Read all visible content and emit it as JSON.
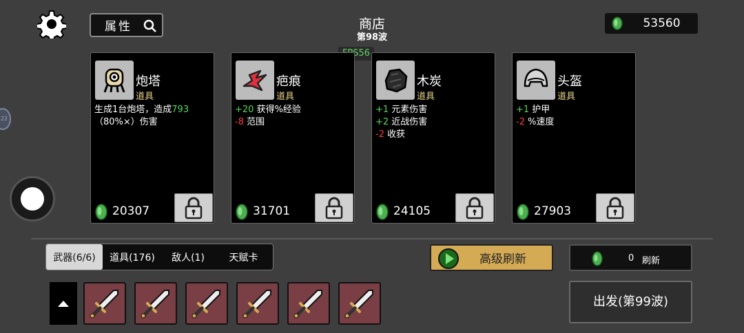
{
  "header": {
    "title": "商店",
    "wave": "第98波",
    "fps": "FPS56",
    "money": "53560",
    "search_label": "属性"
  },
  "side": {
    "badge": "22"
  },
  "cards": [
    {
      "name": "炮塔",
      "type": "道具",
      "icon": "turret-icon",
      "desc": [
        [
          {
            "t": "生成1台炮塔，造成"
          },
          {
            "t": "793",
            "c": "pos"
          },
          {
            "t": "（80%⨯）伤害"
          }
        ]
      ],
      "price": "20307"
    },
    {
      "name": "疤痕",
      "type": "道具",
      "icon": "scar-icon",
      "desc": [
        [
          {
            "t": "+20",
            "c": "pos"
          },
          {
            "t": " 获得%经验"
          }
        ],
        [
          {
            "t": "-8",
            "c": "neg"
          },
          {
            "t": " 范围"
          }
        ]
      ],
      "price": "31701"
    },
    {
      "name": "木炭",
      "type": "道具",
      "icon": "charcoal-icon",
      "desc": [
        [
          {
            "t": "+1",
            "c": "pos"
          },
          {
            "t": " 元素伤害"
          }
        ],
        [
          {
            "t": "+2",
            "c": "pos"
          },
          {
            "t": " 近战伤害"
          }
        ],
        [
          {
            "t": "-2",
            "c": "neg"
          },
          {
            "t": " 收获"
          }
        ]
      ],
      "price": "24105"
    },
    {
      "name": "头盔",
      "type": "道具",
      "icon": "helmet-icon",
      "desc": [
        [
          {
            "t": "+1",
            "c": "pos"
          },
          {
            "t": " 护甲"
          }
        ],
        [
          {
            "t": "-2",
            "c": "neg"
          },
          {
            "t": " %速度"
          }
        ]
      ],
      "price": "27903"
    }
  ],
  "tabs": [
    {
      "label": "武器(6/6)",
      "active": true
    },
    {
      "label": "道具(176)",
      "active": false
    },
    {
      "label": "敌人(1)",
      "active": false
    },
    {
      "label": "天赋卡",
      "active": false
    }
  ],
  "buttons": {
    "advanced_refresh": "高级刷新",
    "refresh_cost": "0",
    "refresh_label": "刷新",
    "depart": "出发(第99波)"
  },
  "weapons": [
    "sword-icon",
    "sword-icon",
    "sword-icon",
    "sword-icon",
    "sword-icon",
    "sword-icon"
  ],
  "colors": {
    "positive": "#57d857",
    "negative": "#ff3b3b",
    "item_type": "#e8d28a",
    "weapon_slot": "#7a3e45",
    "advanced_refresh": "#d4aa55"
  }
}
